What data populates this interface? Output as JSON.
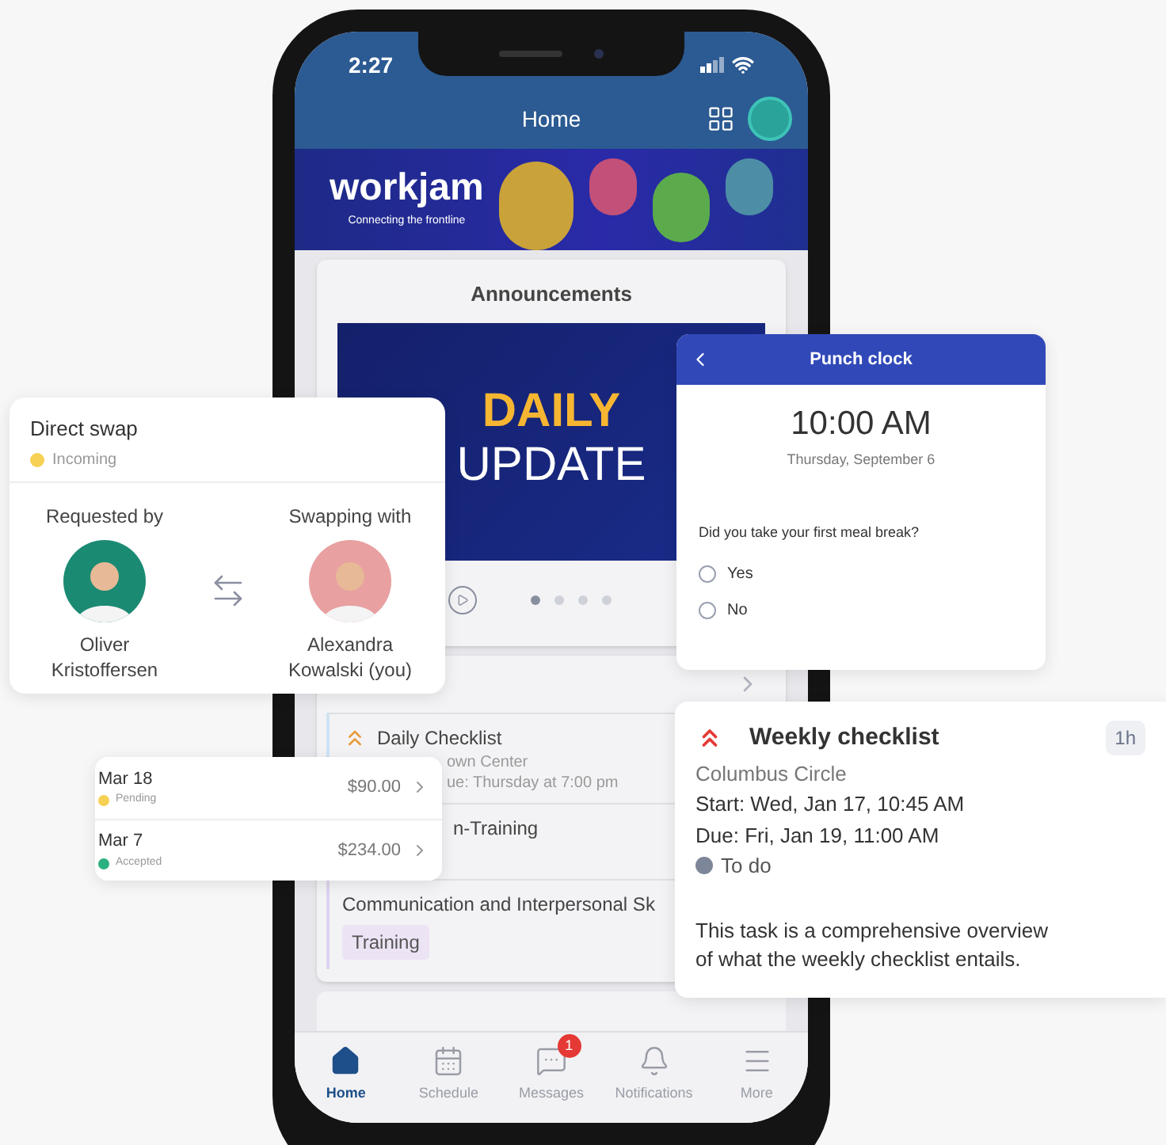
{
  "phone": {
    "status_bar": {
      "time": "2:27"
    },
    "header": {
      "title": "Home"
    },
    "banner": {
      "logo": "workjam",
      "tagline": "Connecting the frontline"
    },
    "announcements": {
      "title": "Announcements",
      "slide": {
        "line_1": "DAILY",
        "line_2": "UPDATE"
      },
      "dots": [
        {
          "selected": true
        },
        {
          "selected": false
        },
        {
          "selected": false
        },
        {
          "selected": false
        }
      ]
    },
    "tasks": [
      {
        "kind": "checklist",
        "title": "Daily Checklist",
        "lines": [
          "own Center",
          "ue: Thursday at 7:00 pm"
        ]
      },
      {
        "kind": "plain",
        "title": "n-Training"
      },
      {
        "kind": "tagged",
        "title": "Communication and Interpersonal Sk",
        "tag": "Training"
      }
    ],
    "tab_bar": [
      {
        "label": "Home",
        "selected": true
      },
      {
        "label": "Schedule",
        "selected": false
      },
      {
        "label": "Messages",
        "selected": false,
        "badge": "1"
      },
      {
        "label": "Notifications",
        "selected": false
      },
      {
        "label": "More",
        "selected": false
      }
    ]
  },
  "direct_swap": {
    "title": "Direct swap",
    "status": {
      "label": "Incoming",
      "color": "#f7d154"
    },
    "requested_by": {
      "label": "Requested by",
      "name": "Oliver Kristoffersen"
    },
    "swapping_with": {
      "label": "Swapping with",
      "name": "Alexandra Kowalski (you)"
    }
  },
  "payments": [
    {
      "date": "Mar 18",
      "status": "Pending",
      "color": "#f7d154",
      "amount": "$90.00"
    },
    {
      "date": "Mar 7",
      "status": "Accepted",
      "color": "#2bb07f",
      "amount": "$234.00"
    }
  ],
  "punch_clock": {
    "title": "Punch clock",
    "time": "10:00 AM",
    "date": "Thursday, September 6",
    "question": "Did you take your first meal break?",
    "options": [
      {
        "label": "Yes",
        "selected": false
      },
      {
        "label": "No",
        "selected": false
      }
    ]
  },
  "weekly_checklist": {
    "title": "Weekly checklist",
    "duration": "1h",
    "location": "Columbus Circle",
    "start": "Start: Wed, Jan 17, 10:45 AM",
    "due": "Due: Fri, Jan 19, 11:00 AM",
    "status": {
      "label": "To do",
      "color": "#7d8598"
    },
    "description": "This task is a comprehensive overview of what the weekly checklist entails."
  }
}
